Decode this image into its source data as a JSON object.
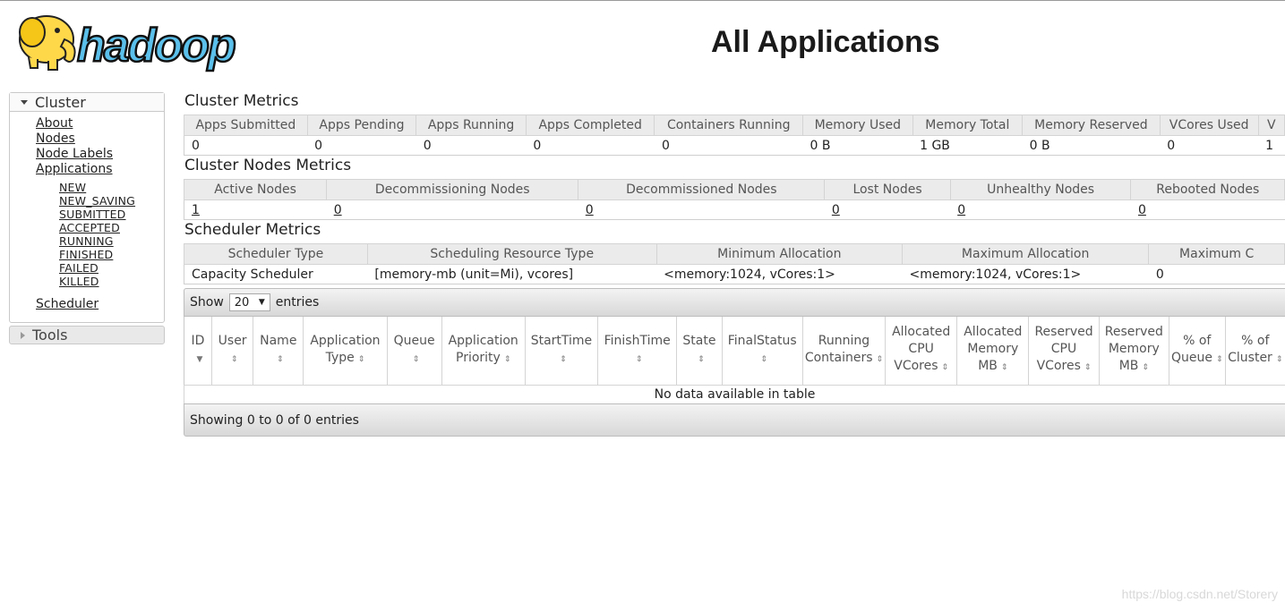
{
  "header": {
    "logo_text": "hadoop",
    "title": "All Applications"
  },
  "nav": {
    "cluster_label": "Cluster",
    "cluster_items": [
      "About",
      "Nodes",
      "Node Labels",
      "Applications"
    ],
    "app_states": [
      "NEW",
      "NEW_SAVING",
      "SUBMITTED",
      "ACCEPTED",
      "RUNNING",
      "FINISHED",
      "FAILED",
      "KILLED"
    ],
    "scheduler_label": "Scheduler",
    "tools_label": "Tools"
  },
  "cluster_metrics": {
    "title": "Cluster Metrics",
    "headers": [
      "Apps Submitted",
      "Apps Pending",
      "Apps Running",
      "Apps Completed",
      "Containers Running",
      "Memory Used",
      "Memory Total",
      "Memory Reserved",
      "VCores Used",
      "V"
    ],
    "values": [
      "0",
      "0",
      "0",
      "0",
      "0",
      "0 B",
      "1 GB",
      "0 B",
      "0",
      "1"
    ]
  },
  "nodes_metrics": {
    "title": "Cluster Nodes Metrics",
    "headers": [
      "Active Nodes",
      "Decommissioning Nodes",
      "Decommissioned Nodes",
      "Lost Nodes",
      "Unhealthy Nodes",
      "Rebooted Nodes"
    ],
    "values": [
      "1",
      "0",
      "0",
      "0",
      "0",
      "0"
    ]
  },
  "scheduler_metrics": {
    "title": "Scheduler Metrics",
    "headers": [
      "Scheduler Type",
      "Scheduling Resource Type",
      "Minimum Allocation",
      "Maximum Allocation",
      "Maximum C"
    ],
    "values": [
      "Capacity Scheduler",
      "[memory-mb (unit=Mi), vcores]",
      "<memory:1024, vCores:1>",
      "<memory:1024, vCores:1>",
      "0"
    ]
  },
  "apps_table": {
    "show_label": "Show",
    "page_size": "20",
    "entries_label": "entries",
    "columns": [
      {
        "l1": "ID",
        "l2": ""
      },
      {
        "l1": "User",
        "l2": ""
      },
      {
        "l1": "Name",
        "l2": ""
      },
      {
        "l1": "Application",
        "l2": "Type"
      },
      {
        "l1": "Queue",
        "l2": ""
      },
      {
        "l1": "Application",
        "l2": "Priority"
      },
      {
        "l1": "StartTime",
        "l2": ""
      },
      {
        "l1": "FinishTime",
        "l2": ""
      },
      {
        "l1": "State",
        "l2": ""
      },
      {
        "l1": "FinalStatus",
        "l2": ""
      },
      {
        "l1": "Running",
        "l2": "Containers"
      },
      {
        "l1": "Allocated",
        "l2": "CPU",
        "l3": "VCores"
      },
      {
        "l1": "Allocated",
        "l2": "Memory",
        "l3": "MB"
      },
      {
        "l1": "Reserved",
        "l2": "CPU",
        "l3": "VCores"
      },
      {
        "l1": "Reserved",
        "l2": "Memory",
        "l3": "MB"
      },
      {
        "l1": "% of",
        "l2": "Queue"
      },
      {
        "l1": "% of",
        "l2": "Cluster"
      }
    ],
    "empty_text": "No data available in table",
    "footer_text": "Showing 0 to 0 of 0 entries"
  },
  "watermark": "https://blog.csdn.net/Storery",
  "colors": {
    "logo_yellow": "#FFD84A",
    "logo_blue": "#5BC0EB",
    "header_bg": "#EBEBEB",
    "toolbar_bg": "#E0E0E0"
  }
}
